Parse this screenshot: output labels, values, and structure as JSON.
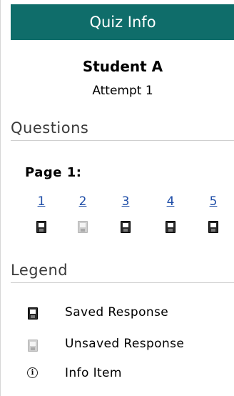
{
  "header": {
    "title": "Quiz Info"
  },
  "student": {
    "name": "Student A",
    "attempt": "Attempt 1"
  },
  "questions": {
    "heading": "Questions",
    "page_label": "Page 1:",
    "items": [
      {
        "number": "1",
        "status": "saved"
      },
      {
        "number": "2",
        "status": "unsaved"
      },
      {
        "number": "3",
        "status": "saved"
      },
      {
        "number": "4",
        "status": "saved"
      },
      {
        "number": "5",
        "status": "saved"
      }
    ]
  },
  "legend": {
    "heading": "Legend",
    "items": [
      {
        "icon": "saved-floppy-icon",
        "label": "Saved Response"
      },
      {
        "icon": "unsaved-floppy-icon",
        "label": "Unsaved Response"
      },
      {
        "icon": "info-icon",
        "label": "Info Item"
      }
    ]
  },
  "colors": {
    "header_bg": "#0f6d6a",
    "link": "#1f4ea8"
  }
}
